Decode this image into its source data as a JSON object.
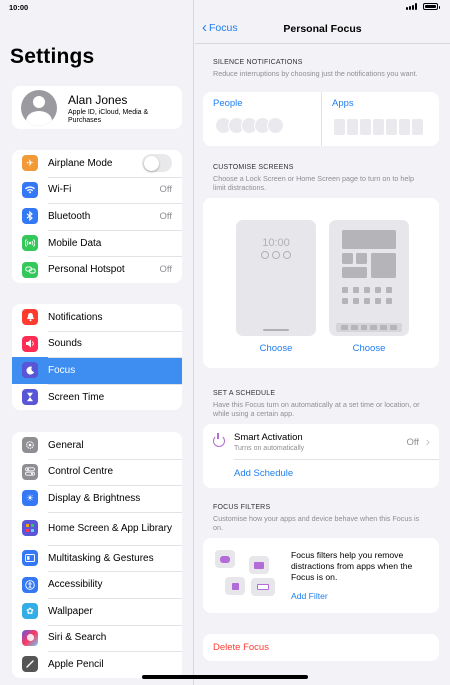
{
  "status_bar": {
    "time": "10:00"
  },
  "sidebar": {
    "title": "Settings",
    "profile": {
      "name": "Alan Jones",
      "subtitle": "Apple ID, iCloud, Media & Purchases"
    },
    "group1": [
      {
        "label": "Airplane Mode",
        "icon": "airplane-icon",
        "color": "#f19a37",
        "value": ""
      },
      {
        "label": "Wi-Fi",
        "icon": "wifi-icon",
        "color": "#3478f6",
        "value": "Off"
      },
      {
        "label": "Bluetooth",
        "icon": "bluetooth-icon",
        "color": "#3478f6",
        "value": "Off"
      },
      {
        "label": "Mobile Data",
        "icon": "antenna-icon",
        "color": "#34c759",
        "value": ""
      },
      {
        "label": "Personal Hotspot",
        "icon": "hotspot-icon",
        "color": "#34c759",
        "value": "Off"
      }
    ],
    "group2": [
      {
        "label": "Notifications",
        "icon": "bell-icon",
        "color": "#ff3b30"
      },
      {
        "label": "Sounds",
        "icon": "speaker-icon",
        "color": "#ff2d55"
      },
      {
        "label": "Focus",
        "icon": "moon-icon",
        "color": "#5856d6",
        "selected": true
      },
      {
        "label": "Screen Time",
        "icon": "hourglass-icon",
        "color": "#5856d6"
      }
    ],
    "group3": [
      {
        "label": "General",
        "icon": "gear-icon",
        "color": "#8e8e93"
      },
      {
        "label": "Control Centre",
        "icon": "switches-icon",
        "color": "#8e8e93"
      },
      {
        "label": "Display & Brightness",
        "icon": "sun-icon",
        "color": "#3478f6"
      },
      {
        "label": "Home Screen & App Library",
        "icon": "grid-icon",
        "color": "#5856d6"
      },
      {
        "label": "Multitasking & Gestures",
        "icon": "multitask-icon",
        "color": "#3478f6"
      },
      {
        "label": "Accessibility",
        "icon": "accessibility-icon",
        "color": "#3478f6"
      },
      {
        "label": "Wallpaper",
        "icon": "flower-icon",
        "color": "#32ade6"
      },
      {
        "label": "Siri & Search",
        "icon": "siri-icon",
        "color": "#333333"
      },
      {
        "label": "Apple Pencil",
        "icon": "pencil-icon",
        "color": "#555555"
      }
    ]
  },
  "detail": {
    "back_label": "Focus",
    "title": "Personal Focus",
    "silence": {
      "header": "SILENCE NOTIFICATIONS",
      "description": "Reduce interruptions by choosing just the notifications you want.",
      "people_label": "People",
      "apps_label": "Apps"
    },
    "screens": {
      "header": "CUSTOMISE SCREENS",
      "description": "Choose a Lock Screen or Home Screen page to turn on to help limit distractions.",
      "lock_time": "10:00",
      "choose_lock": "Choose",
      "choose_home": "Choose"
    },
    "schedule": {
      "header": "SET A SCHEDULE",
      "description": "Have this Focus turn on automatically at a set time or location, or while using a certain app.",
      "smart_title": "Smart Activation",
      "smart_subtitle": "Turns on automatically",
      "smart_value": "Off",
      "add_label": "Add Schedule"
    },
    "filters": {
      "header": "FOCUS FILTERS",
      "description": "Customise how your apps and device behave when this Focus is on.",
      "body": "Focus filters help you remove distractions from apps when the Focus is on.",
      "add_label": "Add Filter"
    },
    "delete_label": "Delete Focus"
  },
  "colors": {
    "accent": "#1f7ef0",
    "selected_row": "#3d8ef0",
    "destructive": "#ff3b30",
    "focus_purple": "#b36bd8"
  }
}
